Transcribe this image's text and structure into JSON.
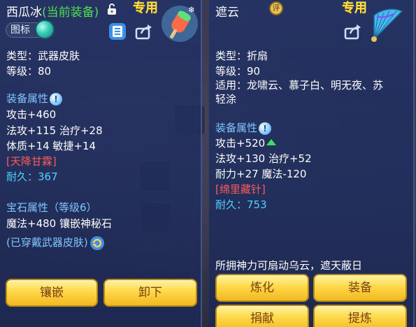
{
  "left_panel": {
    "title": "西瓜冰",
    "equipped_tag": "(当前装备)",
    "exclusive_label": "专用",
    "chip_label": "图标",
    "type_line": "类型：武器皮肤",
    "level_line": "等级：80",
    "attr_title": "装备属性",
    "attrs": [
      "攻击+460",
      "法攻+115 治疗+28",
      "体质+14 敏捷+14"
    ],
    "special": "[天降甘霖]",
    "durability_label": "耐久：",
    "durability_value": "367",
    "gem_title": "宝石属性（等级6）",
    "gem_attr": "魔法+480 镶嵌神秘石",
    "skin_note": "(已穿戴武器皮肤)",
    "buttons": [
      "镶嵌",
      "卸下"
    ]
  },
  "right_panel": {
    "title": "遮云",
    "badge_char": "评",
    "exclusive_label": "专用",
    "type_line": "类型：折扇",
    "level_line": "等级：90",
    "suit_line1": "适用：龙啸云、慕子白、明无夜、苏",
    "suit_line2": "轻涂",
    "attr_title": "装备属性",
    "attrs": [
      "攻击+520",
      "法攻+130 治疗+52",
      "耐力+27 魔法-120"
    ],
    "special": "[绵里藏针]",
    "durability_label": "耐久：",
    "durability_value": "753",
    "flavor": "所拥神力可扇动乌云，遮天蔽日",
    "buttons": [
      "炼化",
      "装备",
      "捐献",
      "提炼"
    ]
  },
  "colors": {
    "panel_bg": "#22326a",
    "section_blue": "#7fc6ff",
    "value_cyan": "#4fd2ff",
    "special_red": "#ff5a5a",
    "equipped_green": "#4ee24e",
    "exclusive_gold": "#ffe04a",
    "button_gold": "#ffd84a"
  }
}
